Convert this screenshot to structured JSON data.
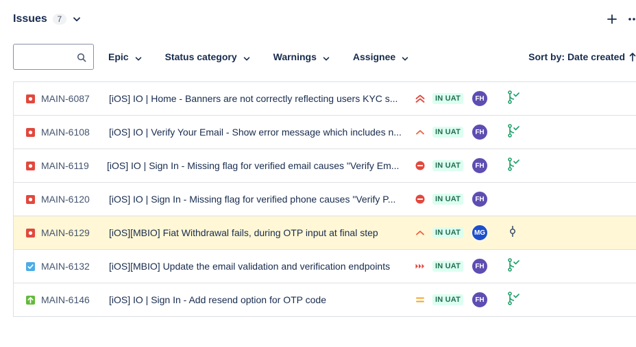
{
  "header": {
    "title": "Issues",
    "count": "7"
  },
  "filters": {
    "search_placeholder": "",
    "items": [
      "Epic",
      "Status category",
      "Warnings",
      "Assignee"
    ],
    "sort_label": "Sort by: Date created"
  },
  "colors": {
    "bug": "#e2483d",
    "task": "#4bade8",
    "story": "#63ba3c",
    "status_bg": "#dcfff1",
    "status_text": "#216e4e",
    "avatar_purple": "#5e4db2",
    "avatar_blue": "#1d4fc9",
    "highlight_row": "#fff7d6",
    "dev_icon": "#22a06b"
  },
  "issues": [
    {
      "type": "bug-icon",
      "key": "MAIN-6087",
      "summary": "[iOS] IO | Home - Banners are not correctly reflecting users KYC s...",
      "priority": "highest-priority-icon",
      "status": "IN UAT",
      "assignee": "FH",
      "dev": "pull-request-merged-icon"
    },
    {
      "type": "bug-icon",
      "key": "MAIN-6108",
      "summary": "[iOS] IO | Verify Your Email - Show error message which includes n...",
      "priority": "high-priority-icon",
      "status": "IN UAT",
      "assignee": "FH",
      "dev": "pull-request-merged-icon"
    },
    {
      "type": "bug-icon",
      "key": "MAIN-6119",
      "summary": "[iOS] IO | Sign In - Missing flag for verified email causes \"Verify Em...",
      "priority": "blocker-priority-icon",
      "status": "IN UAT",
      "assignee": "FH",
      "dev": "pull-request-merged-icon"
    },
    {
      "type": "bug-icon",
      "key": "MAIN-6120",
      "summary": "[iOS] IO | Sign In - Missing flag for verified phone causes \"Verify P...",
      "priority": "blocker-priority-icon",
      "status": "IN UAT",
      "assignee": "FH",
      "dev": ""
    },
    {
      "type": "bug-icon",
      "key": "MAIN-6129",
      "summary": "[iOS][MBIO] Fiat Withdrawal fails, during OTP input at final step",
      "priority": "high-priority-icon",
      "status": "IN UAT",
      "assignee": "MG",
      "dev": "commit-icon"
    },
    {
      "type": "task-icon",
      "key": "MAIN-6132",
      "summary": "[iOS][MBIO] Update the email validation and verification endpoints",
      "priority": "critical-priority-icon",
      "status": "IN UAT",
      "assignee": "FH",
      "dev": "pull-request-merged-icon"
    },
    {
      "type": "story-icon",
      "key": "MAIN-6146",
      "summary": "[iOS] IO | Sign In - Add resend option for OTP code",
      "priority": "medium-priority-icon",
      "status": "IN UAT",
      "assignee": "FH",
      "dev": "pull-request-merged-icon"
    }
  ]
}
